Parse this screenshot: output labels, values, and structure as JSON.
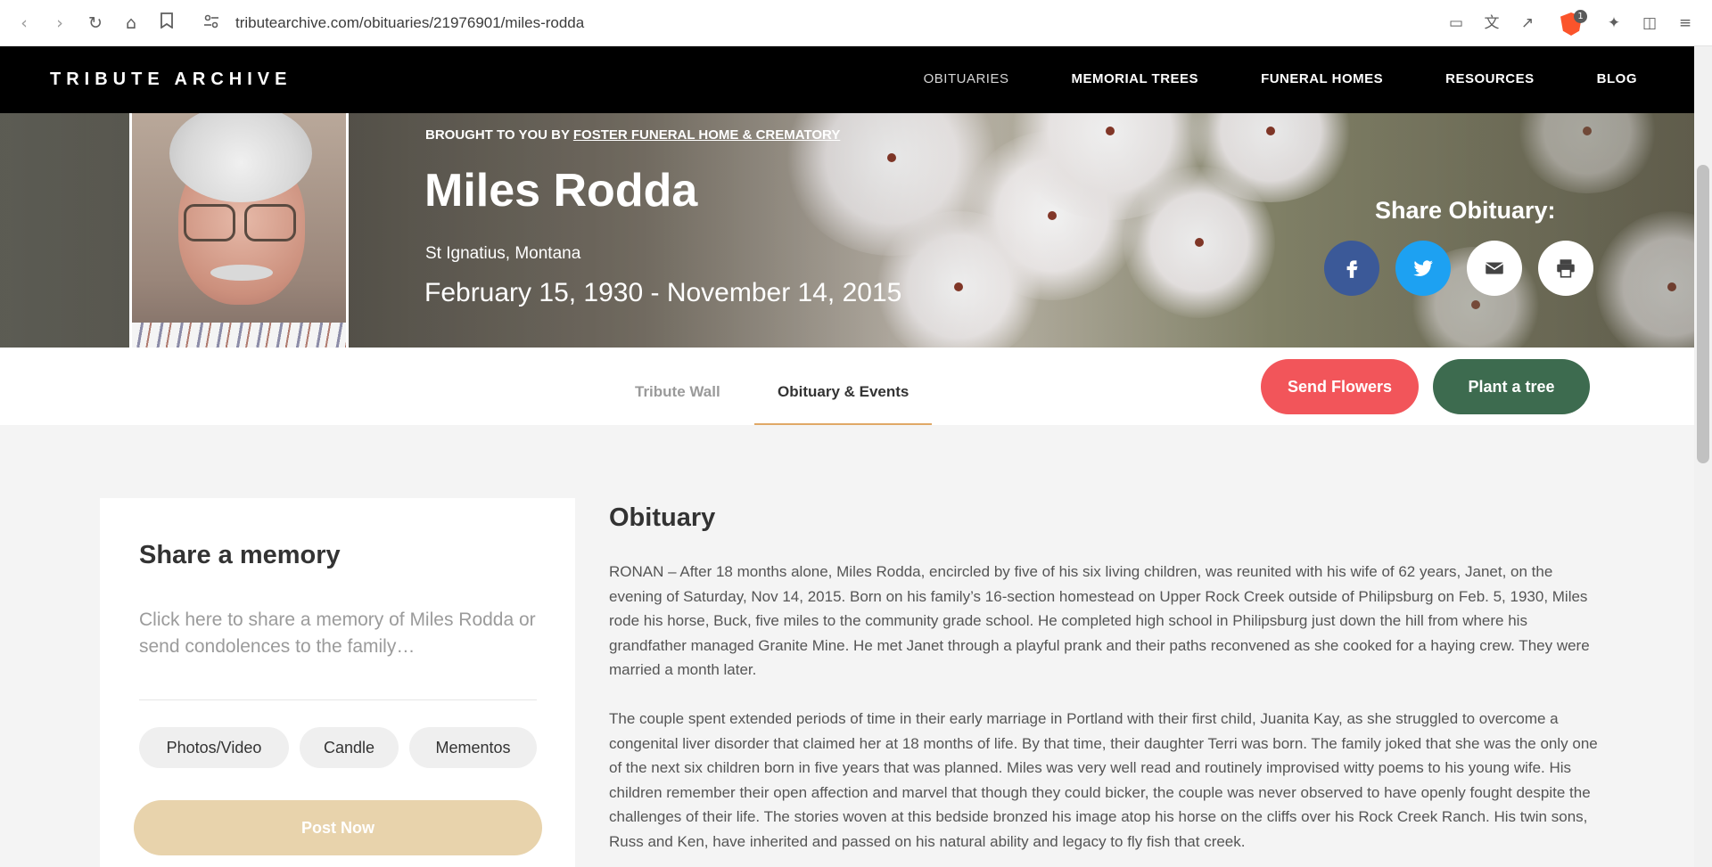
{
  "browser": {
    "url": "tributearchive.com/obituaries/21976901/miles-rodda",
    "extension_badge": "1"
  },
  "site": {
    "logo": "TRIBUTE ARCHIVE",
    "nav": [
      "OBITUARIES",
      "MEMORIAL TREES",
      "FUNERAL HOMES",
      "RESOURCES",
      "BLOG"
    ]
  },
  "hero": {
    "brought_prefix": "BROUGHT TO YOU BY",
    "funeral_home": "FOSTER FUNERAL HOME & CREMATORY",
    "name": "Miles Rodda",
    "location": "St Ignatius, Montana",
    "dates": "February 15, 1930 - November 14, 2015",
    "share_title": "Share Obituary:",
    "share_icons": [
      "facebook-icon",
      "twitter-icon",
      "email-icon",
      "print-icon"
    ],
    "colors": {
      "facebook": "#3b5998",
      "twitter": "#1da1f2"
    }
  },
  "tabs": {
    "tribute_wall": "Tribute Wall",
    "obituary_events": "Obituary & Events",
    "send_flowers": "Send Flowers",
    "plant_tree": "Plant a tree",
    "colors": {
      "send_flowers": "#f2555a",
      "plant_tree": "#3d6b4f",
      "active_underline": "#e0a866"
    }
  },
  "memory": {
    "title": "Share a memory",
    "placeholder": "Click here to share a memory of Miles Rodda or send condolences to the family…",
    "chips": [
      "Photos/Video",
      "Candle",
      "Mementos"
    ],
    "post_label": "Post Now"
  },
  "obituary": {
    "heading": "Obituary",
    "paragraphs": [
      "RONAN – After 18 months alone, Miles Rodda, encircled by five of his six living children, was reunited with his wife of 62 years, Janet, on the evening of Saturday, Nov 14, 2015. Born on his family’s 16-section homestead on Upper Rock Creek outside of Philipsburg on Feb. 5, 1930, Miles rode his horse, Buck, five miles to the community grade school. He completed high school in Philipsburg just down the hill from where his grandfather managed Granite Mine. He met Janet through a playful prank and their paths reconvened as she cooked for a haying crew. They were married a month later.",
      "The couple spent extended periods of time in their early marriage in Portland with their first child, Juanita Kay, as she struggled to overcome a congenital liver disorder that claimed her at 18 months of life. By that time, their daughter Terri was born. The family joked that she was the only one of the next six children born in five years that was planned. Miles was very well read and routinely improvised witty poems to his young wife. His children remember their open affection and marvel that though they could bicker, the couple was never observed to have openly fought despite the challenges of their life. The stories woven at this bedside bronzed his image atop his horse on the cliffs over his Rock Creek Ranch. His twin sons, Russ and Ken, have inherited and passed on his natural ability and legacy to fly fish that creek."
    ]
  }
}
